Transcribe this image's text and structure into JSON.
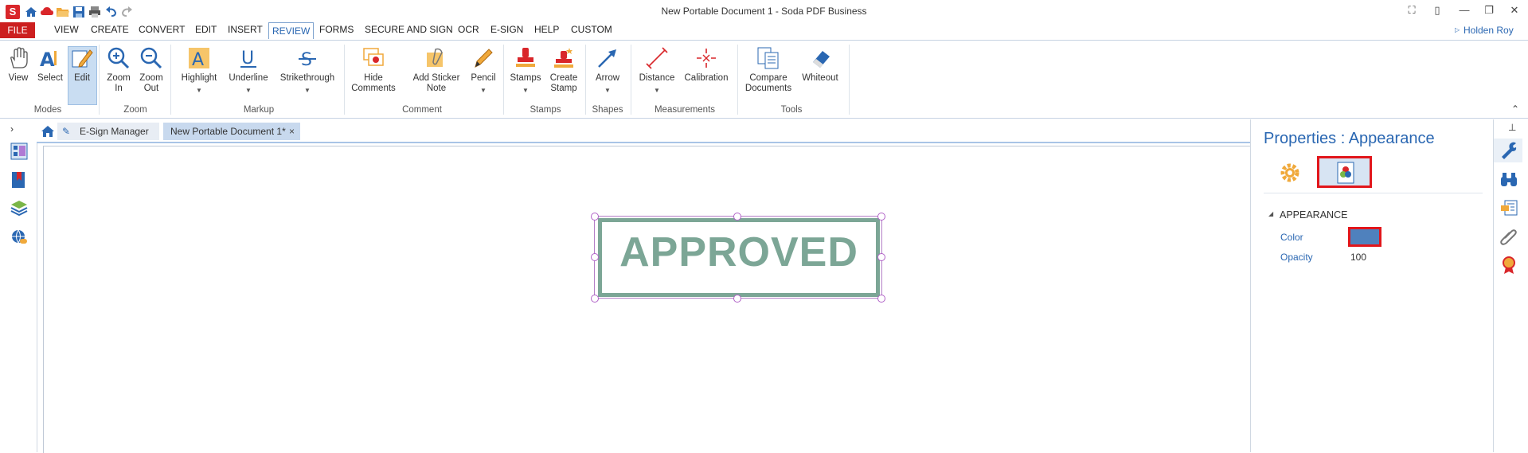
{
  "window": {
    "title": "New Portable Document 1   -   Soda PDF Business",
    "logo_letter": "S"
  },
  "menu": {
    "file": "FILE",
    "items": [
      "VIEW",
      "CREATE",
      "CONVERT",
      "EDIT",
      "INSERT",
      "REVIEW",
      "FORMS",
      "SECURE AND SIGN",
      "OCR",
      "E-SIGN",
      "HELP",
      "CUSTOM"
    ],
    "active": "REVIEW",
    "user": "Holden Roy"
  },
  "ribbon": {
    "view": "View",
    "select": "Select",
    "edit": "Edit",
    "zoom_in_1": "Zoom",
    "zoom_in_2": "In",
    "zoom_out_1": "Zoom",
    "zoom_out_2": "Out",
    "highlight": "Highlight",
    "underline": "Underline",
    "strikethrough": "Strikethrough",
    "hide_1": "Hide",
    "hide_2": "Comments",
    "sticky_1": "Add Sticker",
    "sticky_2": "Note",
    "pencil": "Pencil",
    "stamps": "Stamps",
    "create_stamp_1": "Create",
    "create_stamp_2": "Stamp",
    "arrow": "Arrow",
    "distance": "Distance",
    "calibration": "Calibration",
    "compare_1": "Compare",
    "compare_2": "Documents",
    "whiteout": "Whiteout",
    "groups": {
      "modes": "Modes",
      "zoom": "Zoom",
      "markup": "Markup",
      "comment": "Comment",
      "stamps": "Stamps",
      "shapes": "Shapes",
      "measurements": "Measurements",
      "tools": "Tools"
    }
  },
  "tabs": {
    "esign": "E-Sign Manager",
    "doc": "New Portable Document 1*",
    "close": "×"
  },
  "document": {
    "stamp_text": "APPROVED",
    "stamp_color": "#7ca696"
  },
  "properties": {
    "title": "Properties : Appearance",
    "section": "APPEARANCE",
    "color_label": "Color",
    "color_value": "#4f81bd",
    "opacity_label": "Opacity",
    "opacity_value": "100"
  },
  "colors": {
    "accent": "#2a67b2",
    "file_red": "#cc1f1f",
    "highlight_red": "#e2161b"
  }
}
